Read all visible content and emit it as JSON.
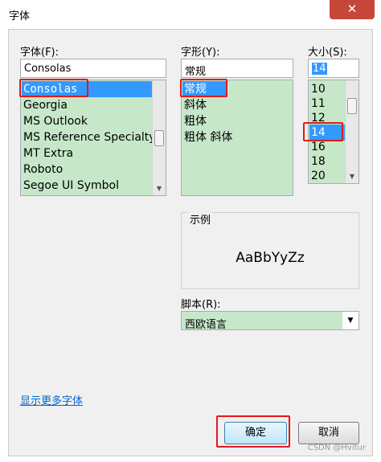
{
  "window": {
    "title": "字体",
    "close_glyph": "✕"
  },
  "font": {
    "label": "字体(F):",
    "value": "Consolas",
    "items": [
      "Consolas",
      "Georgia",
      "MS Outlook",
      "MS Reference Specialty",
      "MT Extra",
      "Roboto",
      "Segoe UI Symbol"
    ],
    "selected": "Consolas"
  },
  "style": {
    "label": "字形(Y):",
    "value": "常规",
    "items": [
      "常规",
      "斜体",
      "粗体",
      "粗体 斜体"
    ],
    "selected": "常规"
  },
  "size": {
    "label": "大小(S):",
    "value": "14",
    "items": [
      "10",
      "11",
      "12",
      "14",
      "16",
      "18",
      "20"
    ],
    "selected": "14"
  },
  "sample": {
    "label": "示例",
    "text": "AaBbYyZz"
  },
  "script": {
    "label": "脚本(R):",
    "value": "西欧语言"
  },
  "links": {
    "more_fonts": "显示更多字体"
  },
  "buttons": {
    "ok": "确定",
    "cancel": "取消"
  },
  "watermark": "CSDN @Hvitur",
  "colors": {
    "list_bg": "#c6e8c9",
    "selection": "#3399ff",
    "highlight_box": "#e01a1a",
    "link": "#0066cc",
    "close_button": "#c7463a"
  }
}
